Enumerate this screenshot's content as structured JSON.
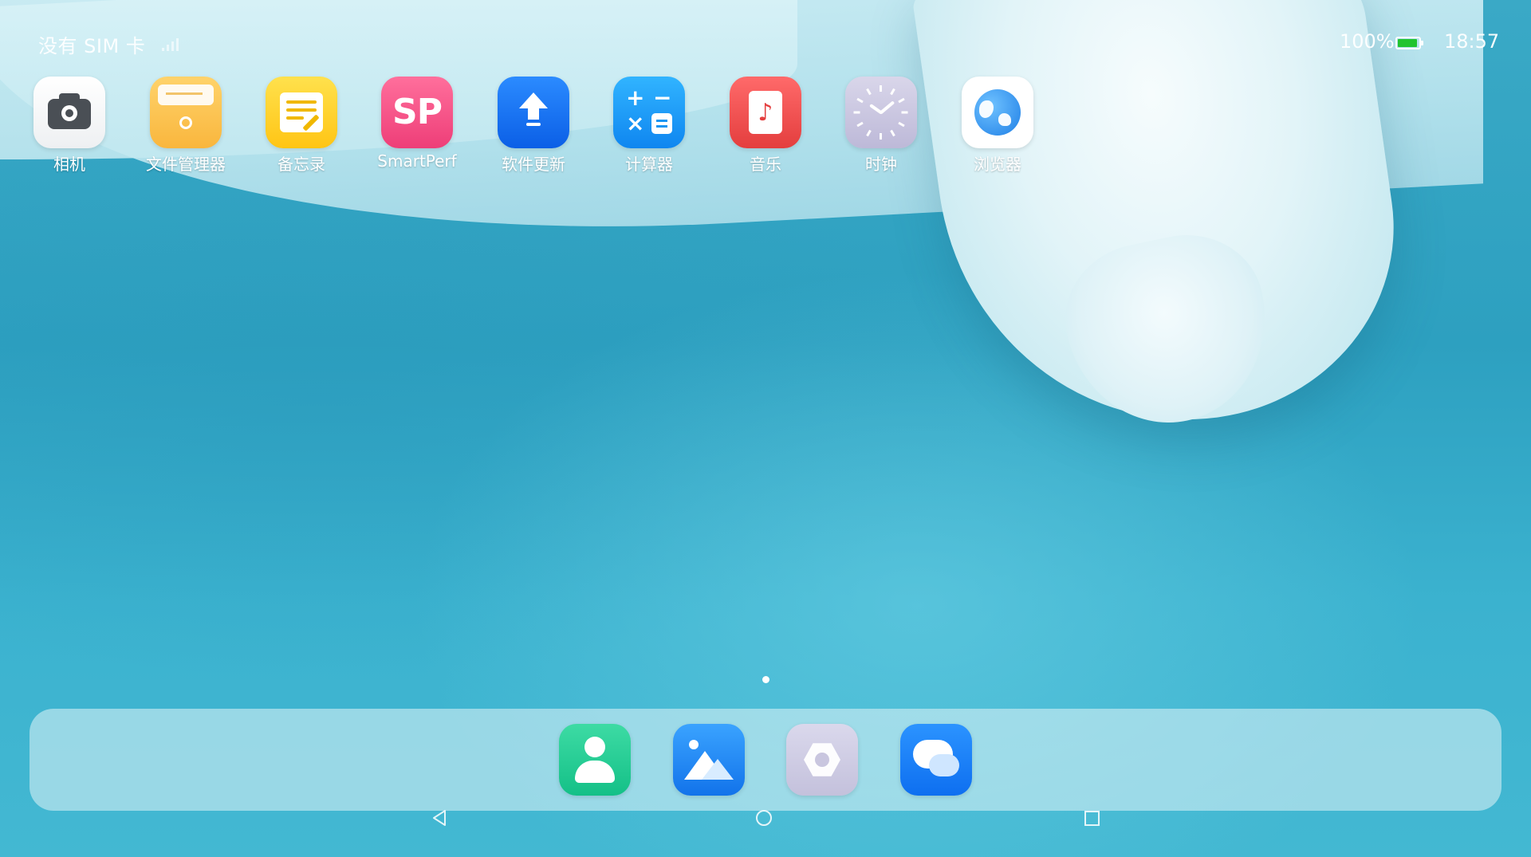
{
  "status_bar": {
    "sim_status": "没有 SIM 卡",
    "battery_percent": "100%",
    "battery_level": 1.0,
    "time": "18:57"
  },
  "apps": [
    {
      "label": "相机",
      "icon": "camera-icon"
    },
    {
      "label": "文件管理器",
      "icon": "folder-icon"
    },
    {
      "label": "备忘录",
      "icon": "notepad-icon"
    },
    {
      "label": "SmartPerf",
      "icon": "smartperf-icon",
      "icon_text": "SP"
    },
    {
      "label": "软件更新",
      "icon": "upload-arrow-icon"
    },
    {
      "label": "计算器",
      "icon": "calculator-icon",
      "symbols": [
        "+",
        "−",
        "×"
      ]
    },
    {
      "label": "音乐",
      "icon": "music-note-icon",
      "icon_text": "♪"
    },
    {
      "label": "时钟",
      "icon": "clock-icon"
    },
    {
      "label": "浏览器",
      "icon": "globe-icon"
    }
  ],
  "dock": [
    {
      "icon": "contacts-icon"
    },
    {
      "icon": "gallery-icon"
    },
    {
      "icon": "settings-icon"
    },
    {
      "icon": "messages-icon"
    }
  ],
  "navigation": [
    "back",
    "home",
    "recents"
  ],
  "page_indicator": {
    "pages": 1,
    "current": 1
  }
}
